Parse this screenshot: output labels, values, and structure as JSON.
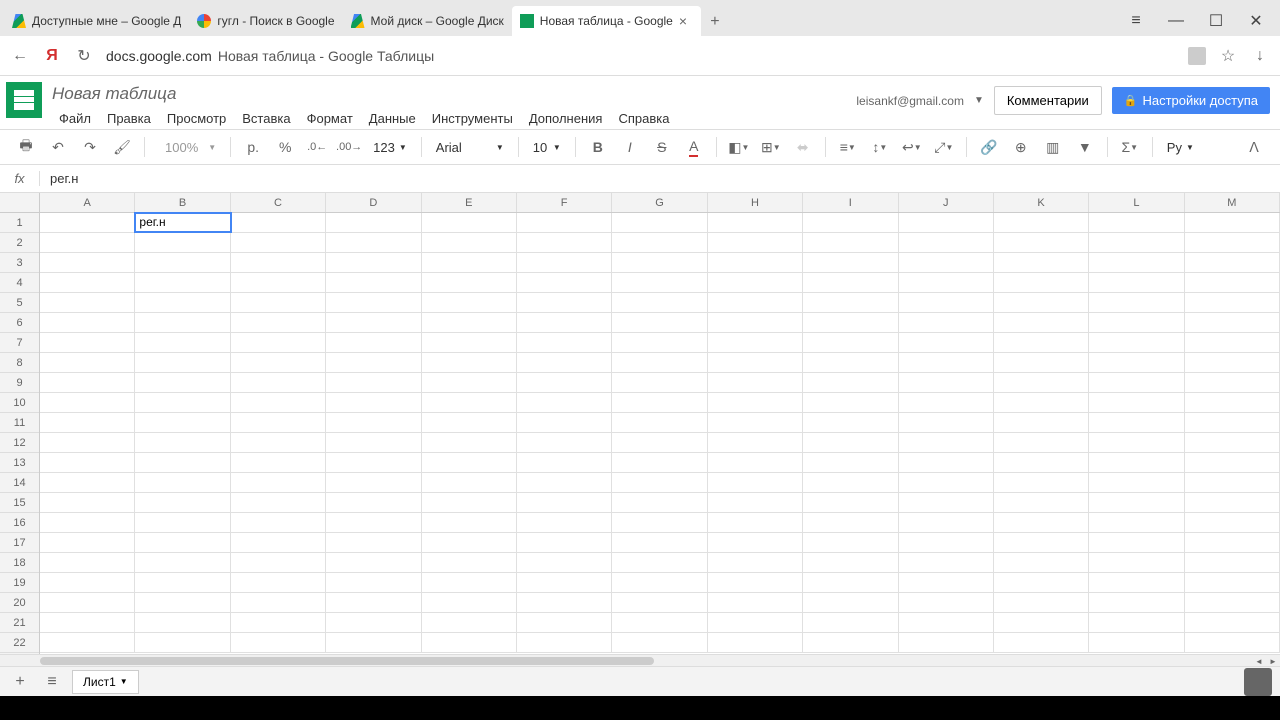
{
  "browser": {
    "tabs": [
      {
        "title": "Доступные мне – Google Д"
      },
      {
        "title": "гугл - Поиск в Google"
      },
      {
        "title": "Мой диск – Google Диск"
      },
      {
        "title": "Новая таблица - Google"
      }
    ],
    "url_domain": "docs.google.com",
    "url_path": "Новая таблица - Google Таблицы"
  },
  "doc": {
    "title": "Новая таблица",
    "user_email": "leisankf@gmail.com",
    "comments_label": "Комментарии",
    "share_label": "Настройки доступа"
  },
  "menu": {
    "file": "Файл",
    "edit": "Правка",
    "view": "Просмотр",
    "insert": "Вставка",
    "format": "Формат",
    "data": "Данные",
    "tools": "Инструменты",
    "addons": "Дополнения",
    "help": "Справка"
  },
  "toolbar": {
    "zoom": "100%",
    "currency": "р.",
    "percent": "%",
    "dec_dec": ".0",
    "dec_inc": ".00",
    "more_formats": "123",
    "font": "Arial",
    "font_size": "10",
    "lang": "Ру"
  },
  "formula": {
    "fx": "fx",
    "value": "рег.н"
  },
  "sheet": {
    "columns": [
      "A",
      "B",
      "C",
      "D",
      "E",
      "F",
      "G",
      "H",
      "I",
      "J",
      "K",
      "L",
      "M"
    ],
    "rows": 22,
    "active_cell": {
      "row": 0,
      "col": 1,
      "value": "рег.н"
    },
    "tab_name": "Лист1"
  }
}
